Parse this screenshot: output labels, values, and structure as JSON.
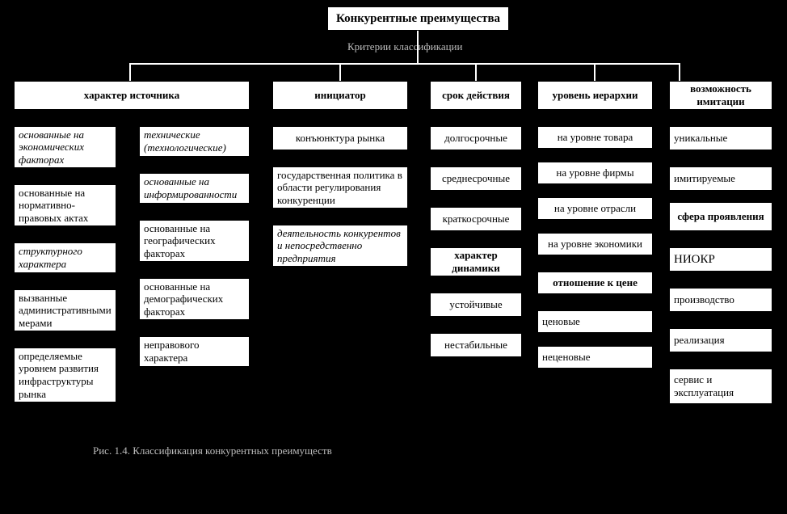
{
  "root": "Конкурентные преимущества",
  "subroot": "Критерии классификации",
  "caption": "Рис. 1.4.   Классификация конкурентных преимуществ",
  "cat": {
    "source": "характер источника",
    "initiator": "инициатор",
    "duration": "срок действия",
    "hierarchy": "уровень иерархии",
    "imitation": "возможность имитации",
    "dynamics": "характер динамики",
    "price": "отношение к цене",
    "sphere": "сфера проявления"
  },
  "source_left": {
    "s0": "основанные на экономических факторах",
    "s1": "основанные на нормативно-правовых актах",
    "s2": "структурного характера",
    "s3": "вызванные административными мерами",
    "s4": "определяемые уровнем развития инфраструктуры рынка"
  },
  "source_right": {
    "r0": "технические (технологические)",
    "r1": "основанные на информированности",
    "r2": "основанные на географических факторах",
    "r3": "основанные на демографических факторах",
    "r4": "неправового характера"
  },
  "initiator": {
    "i0": "конъюнктура рынка",
    "i1": "государственная политика в области регулирования конкуренции",
    "i2": "деятельность конкурентов и непосредственно предприятия"
  },
  "duration": {
    "d0": "долгосрочные",
    "d1": "среднесрочные",
    "d2": "краткосрочные"
  },
  "dynamics": {
    "y0": "устойчивые",
    "y1": "нестабильные"
  },
  "hierarchy": {
    "h0": "на уровне товара",
    "h1": "на уровне фирмы",
    "h2": "на уровне отрасли",
    "h3": "на уровне экономики"
  },
  "price": {
    "p0": "ценовые",
    "p1": "неценовые"
  },
  "imitation": {
    "m0": "уникальные",
    "m1": "имитируемые"
  },
  "sphere": {
    "f0": "НИОКР",
    "f1": "производство",
    "f2": "реализация",
    "f3": "сервис и эксплуатация"
  }
}
